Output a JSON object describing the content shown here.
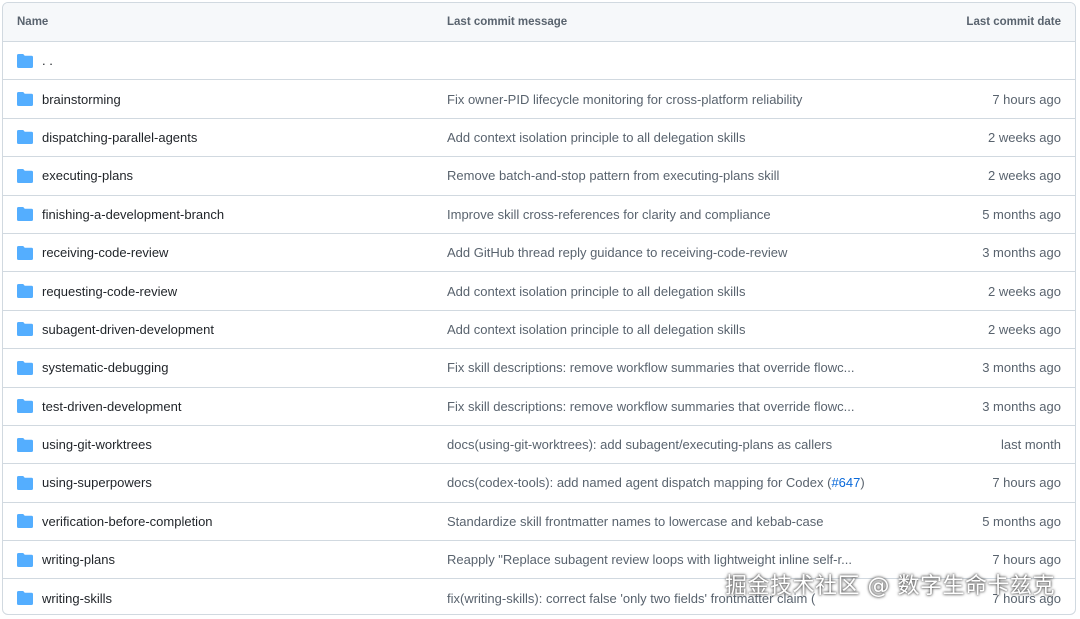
{
  "table": {
    "header": {
      "name": "Name",
      "message": "Last commit message",
      "date": "Last commit date"
    },
    "parent": {
      "name": ". ."
    },
    "rows": [
      {
        "name": "brainstorming",
        "message": "Fix owner-PID lifecycle monitoring for cross-platform reliability",
        "date": "7 hours ago"
      },
      {
        "name": "dispatching-parallel-agents",
        "message": "Add context isolation principle to all delegation skills",
        "date": "2 weeks ago"
      },
      {
        "name": "executing-plans",
        "message": "Remove batch-and-stop pattern from executing-plans skill",
        "date": "2 weeks ago"
      },
      {
        "name": "finishing-a-development-branch",
        "message": "Improve skill cross-references for clarity and compliance",
        "date": "5 months ago"
      },
      {
        "name": "receiving-code-review",
        "message": "Add GitHub thread reply guidance to receiving-code-review",
        "date": "3 months ago"
      },
      {
        "name": "requesting-code-review",
        "message": "Add context isolation principle to all delegation skills",
        "date": "2 weeks ago"
      },
      {
        "name": "subagent-driven-development",
        "message": "Add context isolation principle to all delegation skills",
        "date": "2 weeks ago"
      },
      {
        "name": "systematic-debugging",
        "message": "Fix skill descriptions: remove workflow summaries that override flowc...",
        "date": "3 months ago"
      },
      {
        "name": "test-driven-development",
        "message": "Fix skill descriptions: remove workflow summaries that override flowc...",
        "date": "3 months ago"
      },
      {
        "name": "using-git-worktrees",
        "message": "docs(using-git-worktrees): add subagent/executing-plans as callers",
        "date": "last month"
      },
      {
        "name": "using-superpowers",
        "message": "docs(codex-tools): add named agent dispatch mapping for Codex (",
        "message_link": "#647",
        "message_suffix": ")",
        "date": "7 hours ago"
      },
      {
        "name": "verification-before-completion",
        "message": "Standardize skill frontmatter names to lowercase and kebab-case",
        "date": "5 months ago"
      },
      {
        "name": "writing-plans",
        "message": "Reapply \"Replace subagent review loops with lightweight inline self-r...",
        "date": "7 hours ago"
      },
      {
        "name": "writing-skills",
        "message": "fix(writing-skills): correct false 'only two fields' frontmatter claim (",
        "date": "7 hours ago"
      }
    ]
  },
  "watermark": "掘金技术社区 @ 数字生命卡兹克",
  "colors": {
    "folder": "#54aeff",
    "link": "#0969da",
    "border": "#d1d9e0",
    "header_bg": "#f6f8fa"
  },
  "icons": {
    "folder": "folder-icon"
  }
}
